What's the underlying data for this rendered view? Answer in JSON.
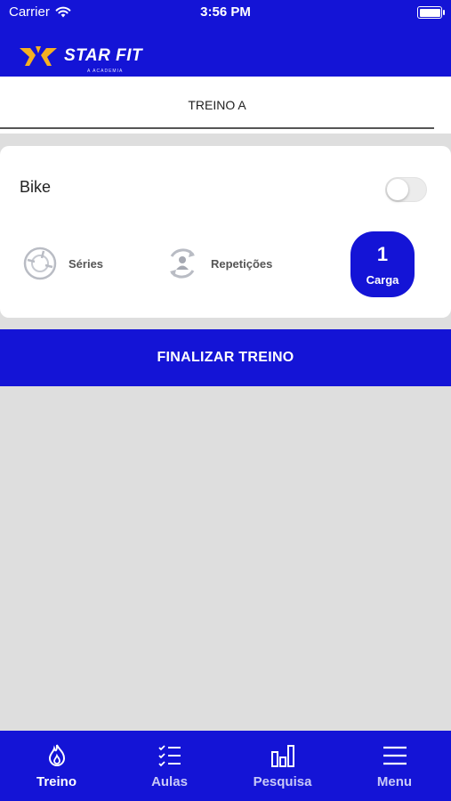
{
  "status_bar": {
    "carrier": "Carrier",
    "time": "3:56 PM"
  },
  "header": {
    "logo_text": "STAR FIT",
    "logo_subtext": "A ACADEMIA"
  },
  "workout": {
    "tab_title": "TREINO A"
  },
  "exercise": {
    "name": "Bike",
    "toggle_on": false,
    "series_label": "Séries",
    "reps_label": "Repetições",
    "load_value": "1",
    "load_label": "Carga"
  },
  "finish_button": {
    "label": "FINALIZAR TREINO"
  },
  "bottom_nav": {
    "items": [
      {
        "label": "Treino",
        "icon": "flame-icon",
        "active": true
      },
      {
        "label": "Aulas",
        "icon": "checklist-icon",
        "active": false
      },
      {
        "label": "Pesquisa",
        "icon": "bar-chart-icon",
        "active": false
      },
      {
        "label": "Menu",
        "icon": "hamburger-menu-icon",
        "active": false
      }
    ]
  },
  "colors": {
    "primary": "#1414d6",
    "background": "#dedede",
    "logo_accent": "#f5b021"
  }
}
